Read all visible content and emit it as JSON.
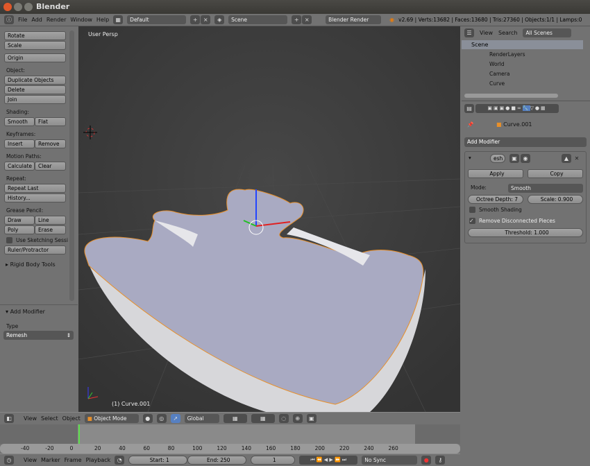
{
  "window": {
    "title": "Blender"
  },
  "topbar": {
    "menus": [
      "File",
      "Add",
      "Render",
      "Window",
      "Help"
    ],
    "layout": "Default",
    "scene": "Scene",
    "engine": "Blender Render",
    "stats": "v2.69 | Verts:13682 | Faces:13680 | Tris:27360 | Objects:1/1 | Lamps:0"
  },
  "toolshelf": {
    "buttons": {
      "rotate": "Rotate",
      "scale": "Scale",
      "origin": "Origin",
      "duplicate": "Duplicate Objects",
      "delete": "Delete",
      "join": "Join",
      "smooth": "Smooth",
      "flat": "Flat",
      "insert": "Insert",
      "remove": "Remove",
      "calculate": "Calculate",
      "clear": "Clear",
      "repeat_last": "Repeat Last",
      "history": "History...",
      "draw": "Draw",
      "line": "Line",
      "poly": "Poly",
      "erase": "Erase",
      "ruler": "Ruler/Protractor"
    },
    "labels": {
      "object": "Object:",
      "shading": "Shading:",
      "keyframes": "Keyframes:",
      "motion": "Motion Paths:",
      "repeat": "Repeat:",
      "grease": "Grease Pencil:"
    },
    "sketching": "Use Sketching Sessi",
    "rigid": "Rigid Body Tools",
    "operator_title": "Add Modifier",
    "type_label": "Type",
    "type_value": "Remesh"
  },
  "viewport": {
    "view_name": "User Persp",
    "object_label": "(1) Curve.001",
    "colors": {
      "mesh": "#a9aac2",
      "outline": "#e8902a"
    }
  },
  "viewport_header": {
    "menus": [
      "View",
      "Select",
      "Object"
    ],
    "mode": "Object Mode",
    "orientation": "Global"
  },
  "outliner": {
    "menus": [
      "View",
      "Search"
    ],
    "filter": "All Scenes",
    "items": [
      "Scene",
      "RenderLayers",
      "World",
      "Camera",
      "Curve"
    ]
  },
  "properties": {
    "object": "Curve.001",
    "add_modifier": "Add Modifier",
    "modifier_name": "esh",
    "apply": "Apply",
    "copy": "Copy",
    "mode_label": "Mode:",
    "mode_value": "Smooth",
    "octree": "Octree Depth: 7",
    "scale": "Scale: 0.900",
    "smooth_shading": "Smooth Shading",
    "smooth_shading_checked": false,
    "remove_disconnected": "Remove Disconnected Pieces",
    "remove_disconnected_checked": true,
    "threshold": "Threshold: 1.000"
  },
  "timeline": {
    "ticks": [
      "-40",
      "-20",
      "0",
      "20",
      "40",
      "60",
      "80",
      "100",
      "120",
      "140",
      "160",
      "180",
      "200",
      "220",
      "240",
      "260"
    ],
    "current_frame": "1",
    "menus": [
      "View",
      "Marker",
      "Frame",
      "Playback"
    ],
    "start": "Start: 1",
    "end": "End: 250",
    "frame": "1",
    "sync": "No Sync"
  }
}
